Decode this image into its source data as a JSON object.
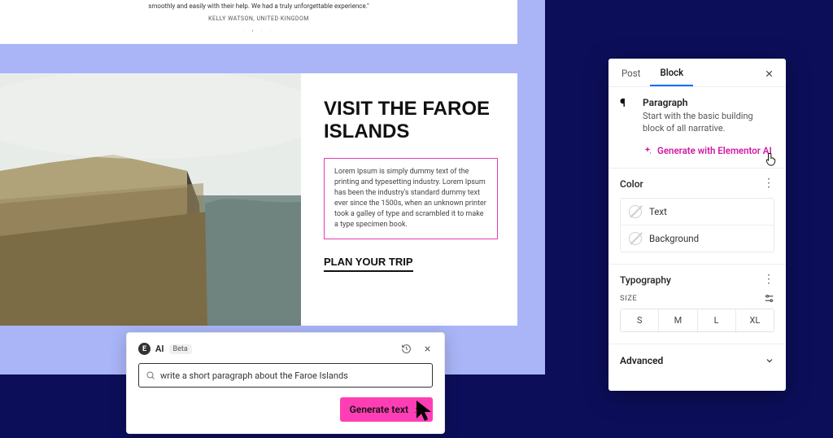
{
  "testimonial": {
    "quote_line": "smoothly and easily with their help. We had a truly unforgettable experience.\"",
    "author": "Kelly Watson, United Kingdom"
  },
  "hero": {
    "title": "Visit the Faroe Islands",
    "lorem": "Lorem Ipsum is simply dummy text of the printing and typesetting industry. Lorem Ipsum has been the industry's standard dummy text ever since the 1500s, when an unknown printer took a galley of type and scrambled it to make a type specimen book.",
    "cta": "Plan Your Trip"
  },
  "ai_popup": {
    "brand_letter": "E",
    "title": "AI",
    "badge": "Beta",
    "prompt_value": "write a short paragraph about the Faroe Islands",
    "generate_label": "Generate text"
  },
  "panel": {
    "tabs": {
      "post": "Post",
      "block": "Block"
    },
    "block": {
      "name": "Paragraph",
      "description": "Start with the basic building block of all narrative.",
      "ai_link": "Generate with Elementor AI"
    },
    "color": {
      "title": "Color",
      "items": [
        "Text",
        "Background"
      ]
    },
    "typography": {
      "title": "Typography",
      "size_label": "Size",
      "sizes": [
        "S",
        "M",
        "L",
        "XL"
      ]
    },
    "advanced": {
      "title": "Advanced"
    }
  }
}
